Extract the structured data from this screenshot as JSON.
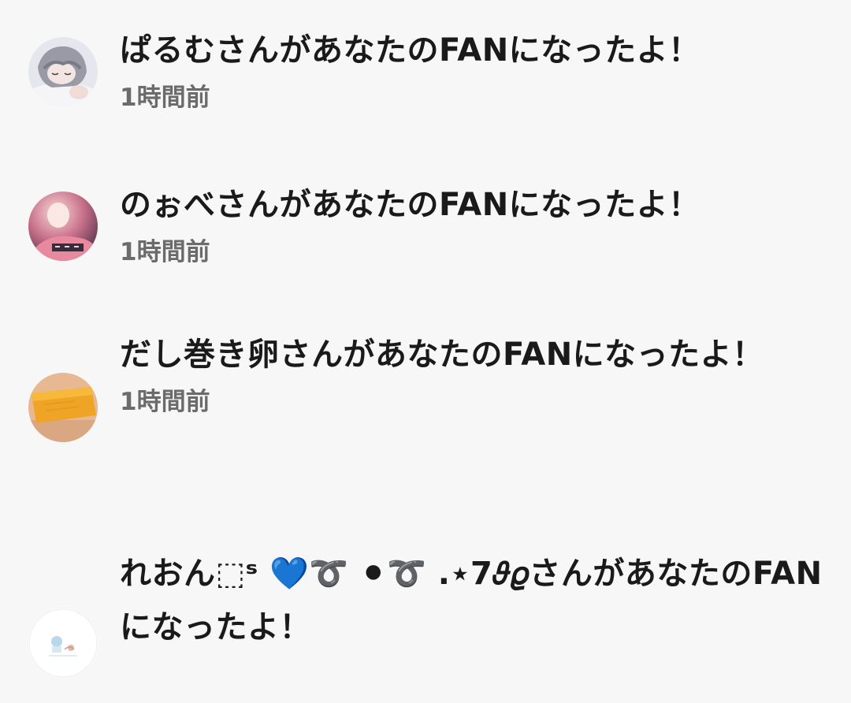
{
  "notifications": [
    {
      "message": "ぱるむさんがあなたのFANになったよ！",
      "time": "1時間前",
      "avatar_icon": "sleeping-anime-girl-avatar"
    },
    {
      "message": "のぉべさんがあなたのFANになったよ！",
      "time": "1時間前",
      "avatar_icon": "glowing-person-avatar"
    },
    {
      "message": "だし巻き卵さんがあなたのFANになったよ！",
      "time": "1時間前",
      "avatar_icon": "rolled-omelette-avatar"
    },
    {
      "message": "れおん⬚ˢ 💙➰ ⚫➰ .⋆7𝜗𝜚さんがあなたのFANになったよ！",
      "avatar_icon": "small-doodle-avatar"
    }
  ],
  "colors": {
    "background": "#f7f7f7",
    "message_text": "#1a1a1a",
    "time_text": "#6b6b6b"
  }
}
